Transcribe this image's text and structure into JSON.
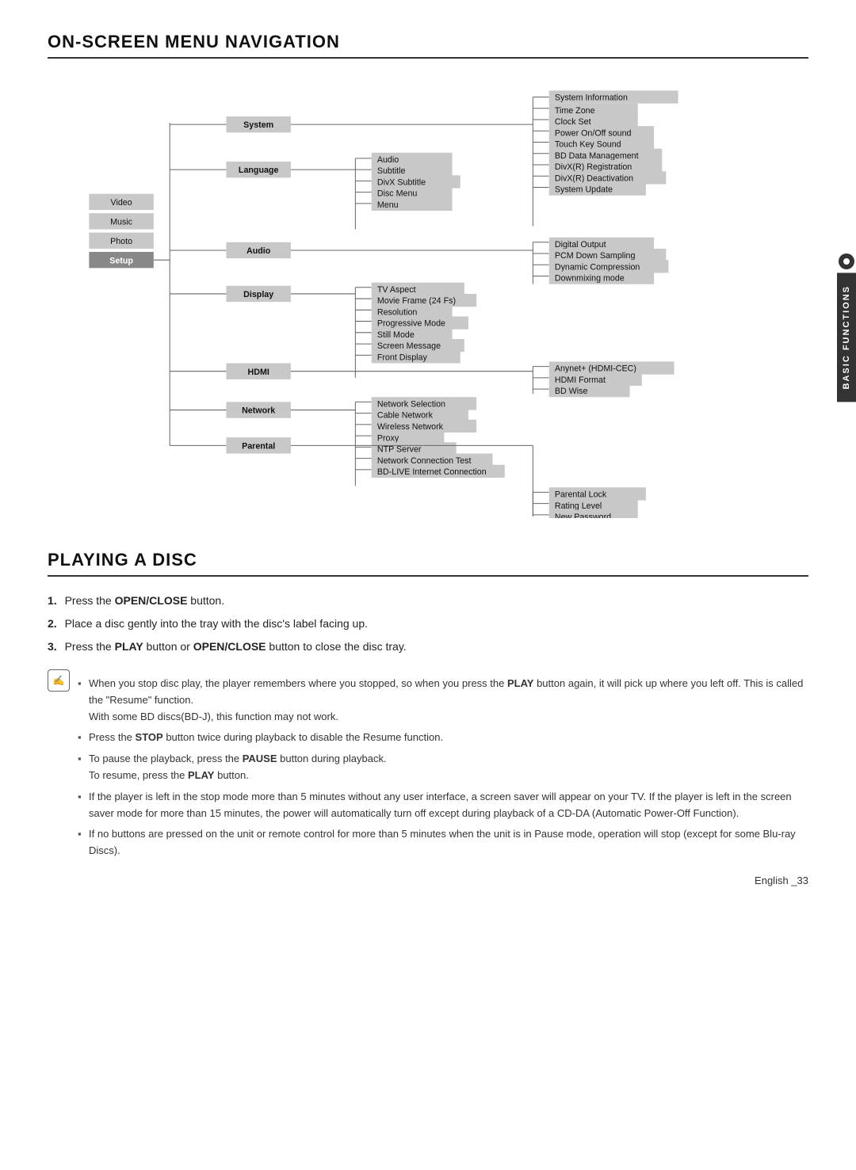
{
  "page": {
    "section1_title": "ON-SCREEN MENU NAVIGATION",
    "section2_title": "PLAYING A DISC",
    "side_tab_label": "BASIC FUNCTIONS"
  },
  "menu_diagram": {
    "left_items": [
      {
        "label": "Video",
        "bold": false
      },
      {
        "label": "Music",
        "bold": false
      },
      {
        "label": "Photo",
        "bold": false
      },
      {
        "label": "Setup",
        "bold": true
      }
    ],
    "system_branch": {
      "root": "System",
      "sub": [],
      "right": [
        "System Information",
        "Time Zone",
        "Clock Set",
        "Power On/Off sound",
        "Touch Key Sound",
        "BD Data Management",
        "DivX(R) Registration",
        "DivX(R) Deactivation",
        "System Update"
      ]
    },
    "language_branch": {
      "root": "Language",
      "sub": [
        "Audio",
        "Subtitle",
        "DivX Subtitle",
        "Disc Menu",
        "Menu"
      ],
      "right": []
    },
    "audio_branch": {
      "root": "Audio",
      "right": [
        "Digital Output",
        "PCM Down Sampling",
        "Dynamic Compression",
        "Downmixing mode"
      ]
    },
    "display_branch": {
      "root": "Display",
      "sub": [
        "TV Aspect",
        "Movie Frame (24 Fs)",
        "Resolution",
        "Progressive Mode",
        "Still Mode",
        "Screen Message",
        "Front Display"
      ],
      "right": []
    },
    "hdmi_branch": {
      "root": "HDMI",
      "right": [
        "Anynet+ (HDMI-CEC)",
        "HDMI Format",
        "BD Wise"
      ]
    },
    "network_branch": {
      "root": "Network",
      "sub": [
        "Network Selection",
        "Cable Network",
        "Wireless Network",
        "Proxy",
        "NTP Server",
        "Network Connection Test",
        "BD-LIVE Internet Connection"
      ],
      "right": []
    },
    "parental_branch": {
      "root": "Parental",
      "right": [
        "Parental Lock",
        "Rating Level",
        "New Password"
      ]
    }
  },
  "playing_disc": {
    "steps": [
      {
        "num": "1.",
        "text_before": "Press the ",
        "bold": "OPEN/CLOSE",
        "text_after": " button."
      },
      {
        "num": "2.",
        "text_before": "Place a disc gently into the tray with the disc's label facing up.",
        "bold": "",
        "text_after": ""
      },
      {
        "num": "3.",
        "text_before": "Press the ",
        "bold1": "PLAY",
        "text_mid": " button or ",
        "bold2": "OPEN/CLOSE",
        "text_after": " button to close the disc tray."
      }
    ],
    "note_icon": "✍",
    "note_bullets": [
      {
        "text_before": "When you stop disc play, the player remembers where you stopped, so when you press the ",
        "bold": "PLAY",
        "text_after": " button again, it will pick up where you left off. This is called the \"Resume\" function. With some BD discs(BD-J), this function may not work."
      },
      {
        "text_before": "Press the ",
        "bold": "STOP",
        "text_after": " button twice during playback to disable the Resume function."
      },
      {
        "text_before": "To pause the playback, press the ",
        "bold": "PAUSE",
        "text_after": " button during playback. To resume, press the ",
        "bold2": "PLAY",
        "text_after2": " button."
      },
      {
        "plain": "If the player is left in the stop mode more than 5 minutes without any user interface, a screen saver will appear on your TV. If the player is left in the screen saver mode for more than 15 minutes, the power will automatically turn off except during playback of a CD-DA (Automatic Power-Off Function)."
      },
      {
        "plain": "If no buttons are pressed on the unit or remote control for more than 5 minutes when the unit is in Pause mode, operation will stop (except for some Blu-ray Discs)."
      }
    ]
  },
  "footer": {
    "text": "English _33"
  }
}
